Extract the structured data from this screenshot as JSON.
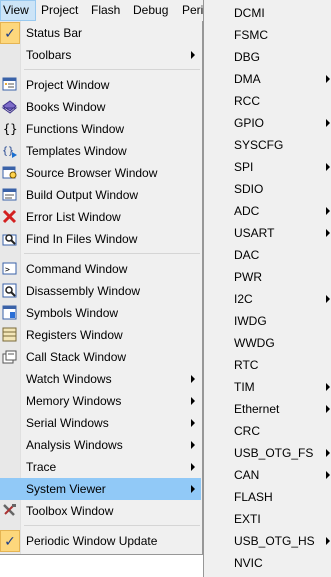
{
  "menubar": {
    "items": [
      "View",
      "Project",
      "Flash",
      "Debug",
      "Peri"
    ]
  },
  "view_menu": {
    "items": [
      {
        "label": "Status Bar",
        "icon": "check-icon",
        "checked": true
      },
      {
        "label": "Toolbars",
        "submenu": true
      },
      {
        "label": "Project Window",
        "icon": "project-window-icon"
      },
      {
        "label": "Books Window",
        "icon": "books-icon"
      },
      {
        "label": "Functions Window",
        "icon": "braces-icon"
      },
      {
        "label": "Templates Window",
        "icon": "templates-icon"
      },
      {
        "label": "Source Browser Window",
        "icon": "source-browser-icon"
      },
      {
        "label": "Build Output Window",
        "icon": "build-output-icon"
      },
      {
        "label": "Error List Window",
        "icon": "error-icon"
      },
      {
        "label": "Find In Files Window",
        "icon": "find-in-files-icon"
      },
      {
        "label": "Command Window",
        "icon": "command-icon"
      },
      {
        "label": "Disassembly Window",
        "icon": "disassembly-icon"
      },
      {
        "label": "Symbols Window",
        "icon": "symbols-icon"
      },
      {
        "label": "Registers Window",
        "icon": "registers-icon"
      },
      {
        "label": "Call Stack Window",
        "icon": "call-stack-icon"
      },
      {
        "label": "Watch Windows",
        "submenu": true
      },
      {
        "label": "Memory Windows",
        "submenu": true
      },
      {
        "label": "Serial Windows",
        "submenu": true
      },
      {
        "label": "Analysis Windows",
        "submenu": true
      },
      {
        "label": "Trace",
        "submenu": true
      },
      {
        "label": "System Viewer",
        "submenu": true,
        "highlighted": true
      },
      {
        "label": "Toolbox Window",
        "icon": "toolbox-icon"
      },
      {
        "label": "Periodic Window Update",
        "icon": "check-icon",
        "checked": true
      }
    ]
  },
  "system_viewer_menu": {
    "items": [
      {
        "label": "DCMI"
      },
      {
        "label": "FSMC"
      },
      {
        "label": "DBG"
      },
      {
        "label": "DMA",
        "submenu": true
      },
      {
        "label": "RCC"
      },
      {
        "label": "GPIO",
        "submenu": true
      },
      {
        "label": "SYSCFG"
      },
      {
        "label": "SPI",
        "submenu": true
      },
      {
        "label": "SDIO"
      },
      {
        "label": "ADC",
        "submenu": true
      },
      {
        "label": "USART",
        "submenu": true
      },
      {
        "label": "DAC"
      },
      {
        "label": "PWR"
      },
      {
        "label": "I2C",
        "submenu": true
      },
      {
        "label": "IWDG"
      },
      {
        "label": "WWDG"
      },
      {
        "label": "RTC"
      },
      {
        "label": "TIM",
        "submenu": true
      },
      {
        "label": "Ethernet",
        "submenu": true
      },
      {
        "label": "CRC"
      },
      {
        "label": "USB_OTG_FS",
        "submenu": true
      },
      {
        "label": "CAN",
        "submenu": true
      },
      {
        "label": "FLASH"
      },
      {
        "label": "EXTI"
      },
      {
        "label": "USB_OTG_HS",
        "submenu": true
      },
      {
        "label": "NVIC"
      }
    ]
  },
  "colors": {
    "menu_bg": "#f0f0f0",
    "highlight": "#91c9f7",
    "check_bg": "#fdd77c"
  }
}
